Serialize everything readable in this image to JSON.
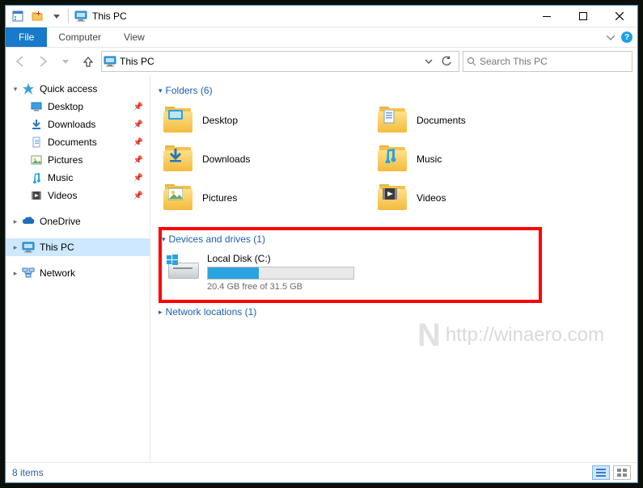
{
  "window_title": "This PC",
  "ribbon": {
    "file": "File",
    "tabs": [
      "Computer",
      "View"
    ]
  },
  "nav": {
    "address": "This PC",
    "search_placeholder": "Search This PC"
  },
  "tree": {
    "quick_access": "Quick access",
    "quick_items": [
      {
        "label": "Desktop",
        "icon": "desktop"
      },
      {
        "label": "Downloads",
        "icon": "downloads"
      },
      {
        "label": "Documents",
        "icon": "documents"
      },
      {
        "label": "Pictures",
        "icon": "pictures"
      },
      {
        "label": "Music",
        "icon": "music"
      },
      {
        "label": "Videos",
        "icon": "videos"
      }
    ],
    "onedrive": "OneDrive",
    "this_pc": "This PC",
    "network": "Network"
  },
  "groups": {
    "folders": {
      "label": "Folders",
      "count": 6
    },
    "drives": {
      "label": "Devices and drives",
      "count": 1
    },
    "network": {
      "label": "Network locations",
      "count": 1
    }
  },
  "folders": [
    {
      "label": "Desktop",
      "overlay": "desktop"
    },
    {
      "label": "Documents",
      "overlay": "documents"
    },
    {
      "label": "Downloads",
      "overlay": "downloads"
    },
    {
      "label": "Music",
      "overlay": "music"
    },
    {
      "label": "Pictures",
      "overlay": "pictures"
    },
    {
      "label": "Videos",
      "overlay": "videos"
    }
  ],
  "drive": {
    "name": "Local Disk (C:)",
    "free_text": "20.4 GB free of 31.5 GB",
    "used_pct": 35
  },
  "watermark": "http://winaero.com",
  "status": {
    "items_text": "8 items"
  }
}
